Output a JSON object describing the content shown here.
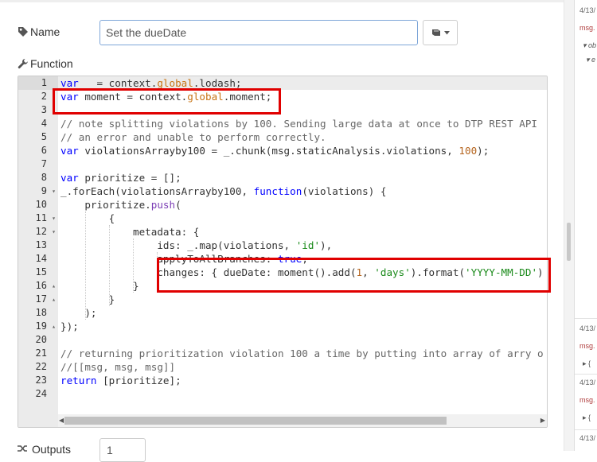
{
  "node_editor": {
    "name_label": "Name",
    "name_value": "Set the dueDate",
    "function_label": "Function",
    "outputs_label": "Outputs",
    "outputs_value": "1"
  },
  "code_lines": [
    "var _ = context.global.lodash;",
    "var moment = context.global.moment;",
    "",
    "// note splitting violations by 100. Sending large data at once to DTP REST API",
    "// an error and unable to perform correctly.",
    "var violationsArrayby100 = _.chunk(msg.staticAnalysis.violations, 100);",
    "",
    "var prioritize = [];",
    "_.forEach(violationsArrayby100, function(violations) {",
    "    prioritize.push(",
    "        {",
    "            metadata: {",
    "                ids: _.map(violations, 'id'),",
    "                applyToAllBranches: true,",
    "                changes: { dueDate: moment().add(1, 'days').format('YYYY-MM-DD')",
    "            }",
    "        }",
    "    );",
    "});",
    "",
    "// returning prioritization violation 100 a time by putting into array of arry o",
    "//[[msg, msg, msg]]",
    "return [prioritize];",
    ""
  ],
  "line_numbers": [
    "1",
    "2",
    "3",
    "4",
    "5",
    "6",
    "7",
    "8",
    "9",
    "10",
    "11",
    "12",
    "13",
    "14",
    "15",
    "16",
    "17",
    "18",
    "19",
    "20",
    "21",
    "22",
    "23",
    "24"
  ],
  "debug_sidebar": {
    "entries": [
      {
        "time": "4/13/",
        "topic": "msg."
      },
      {
        "time": "4/13/",
        "topic": "msg."
      },
      {
        "time": "4/13/",
        "topic": "msg."
      },
      {
        "time": "4/13/",
        "topic": ""
      }
    ],
    "tree_items": [
      "▾ ob",
      "▾ e"
    ],
    "collapsed_items": [
      "▸ {",
      "▸ {"
    ]
  },
  "colors": {
    "highlight_box": "#e00000",
    "keyword": "#0000ff",
    "global_property": "#c87414",
    "string": "#1a8a1a",
    "comment": "#676767"
  }
}
